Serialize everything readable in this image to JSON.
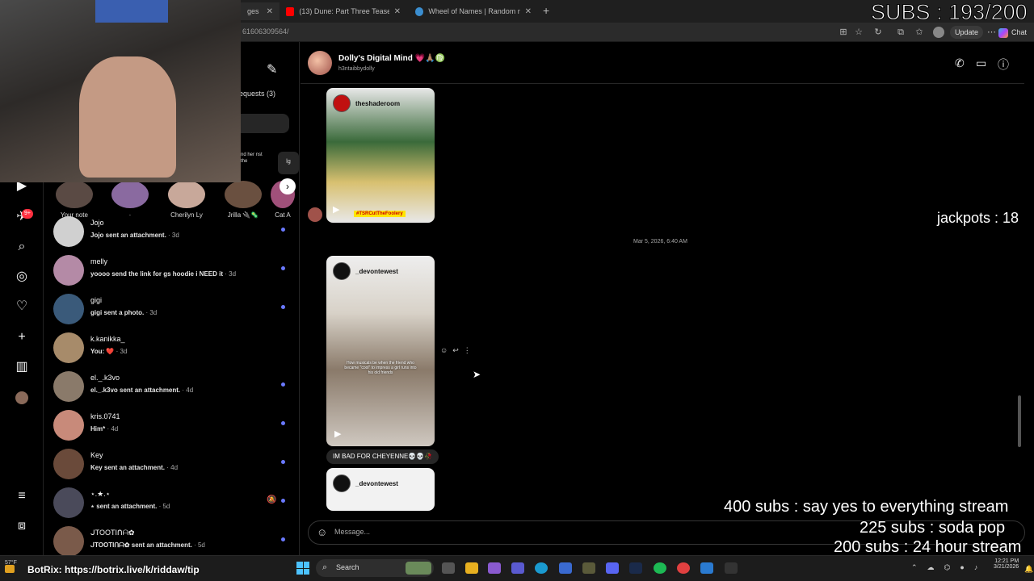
{
  "browser": {
    "tabs": [
      {
        "label": "ges",
        "color": "#e1306c"
      },
      {
        "label": "(13) Dune: Part Three Teaser Traile",
        "color": "#ff0000"
      },
      {
        "label": "Wheel of Names | Random name",
        "color": "#3b8ed0"
      }
    ],
    "url": "61606309564/",
    "update_label": "Update",
    "chat_label": "Chat"
  },
  "inbox": {
    "requests_label": "equests (3)",
    "notes": [
      {
        "label": "Your note"
      },
      {
        "label": "·"
      },
      {
        "label": "Cherilyn Ly"
      },
      {
        "label": "Jrilla 🔌🦠"
      },
      {
        "label": "Cat A"
      }
    ],
    "note_card_text": "nd her nst the",
    "note_card_partial": "lg",
    "conversations": [
      {
        "name": "Jojo",
        "preview": "Jojo sent an attachment.",
        "time": " · 3d",
        "color": "#d0d0d0",
        "unread": true
      },
      {
        "name": "melly",
        "preview": "yoooo send the link for gs hoodie i NEED it",
        "time": " · 3d",
        "color": "#b48aa6",
        "unread": true
      },
      {
        "name": "gigi",
        "preview": "gigi sent a photo.",
        "time": " · 3d",
        "color": "#3a5a7a",
        "unread": true
      },
      {
        "name": "k.kanikka_",
        "preview": "You: ❤️",
        "time": " · 3d",
        "color": "#a78b6a",
        "unread": false
      },
      {
        "name": "el._.k3vo",
        "preview": "el._.k3vo sent an attachment.",
        "time": " · 4d",
        "color": "#8a7a6a",
        "unread": true
      },
      {
        "name": "kris.0741",
        "preview": "Him*",
        "time": " · 4d",
        "color": "#c88a7a",
        "unread": true
      },
      {
        "name": "Key",
        "preview": "Key sent an attachment.",
        "time": " · 4d",
        "color": "#6a4a3a",
        "unread": true
      },
      {
        "name": "⋆.★.⋆",
        "preview": "⋆ sent an attachment.",
        "time": " · 5d",
        "color": "#4a4a5a",
        "unread": true,
        "muted": true
      },
      {
        "name": "ᒍTOOTIᑎᗩ✿",
        "preview": "ᒍTOOTIᑎᗩ✿ sent an attachment.",
        "time": " · 5d",
        "color": "#7a5a4a",
        "unread": true
      }
    ]
  },
  "nav": {
    "badge": "9+"
  },
  "thread": {
    "name": "Dolly's Digital Mind 💗🙏🏽♍",
    "username": "h3ntaibbydolly",
    "post1_owner": "theshaderoom",
    "post1_caption": "#TSRCutTheFoolery",
    "timestamp": "Mar 5, 2026, 6:40 AM",
    "post2_owner": "_devontewest",
    "post2_caption": "How musicals be when the friend who became \"cool\" to impress a girl runs into his old friends",
    "message": "IM BAD FOR CHEYENNE💀💀🥀",
    "post3_owner": "_devontewest",
    "composer_placeholder": "Message..."
  },
  "overlays": {
    "subs_counter": "SUBS : 193/200",
    "jackpots": "jackpots : 18",
    "goal_400": "400 subs :  say yes to everything stream",
    "goal_225": "225 subs :  soda pop",
    "goal_200": "200 subs : 24 hour stream",
    "botrix": "BotRix: https://botrix.live/k/riddaw/tip"
  },
  "taskbar": {
    "weather": "57°F",
    "search_label": "Search",
    "time": "12:21 PM",
    "date": "3/21/2026"
  }
}
